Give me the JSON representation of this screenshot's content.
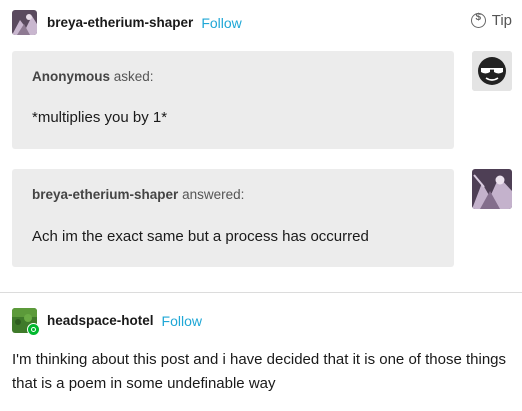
{
  "header": {
    "blog_name": "breya-etherium-shaper",
    "follow_label": "Follow",
    "tip_label": "Tip"
  },
  "ask": {
    "asker_name": "Anonymous",
    "asked_suffix": "asked:",
    "question": "*multiplies you by 1*"
  },
  "answer": {
    "answerer_name": "breya-etherium-shaper",
    "answered_suffix": "answered:",
    "text": "Ach im the exact same but a process has occurred"
  },
  "reblog": {
    "blog_name": "headspace-hotel",
    "follow_label": "Follow",
    "text": "I'm thinking about this post and i have decided that it is one of those things that is a poem in some undefinable way"
  },
  "colors": {
    "follow": "#1fa7d6",
    "bubble": "#ececec",
    "reblog_badge": "#00b82e"
  }
}
